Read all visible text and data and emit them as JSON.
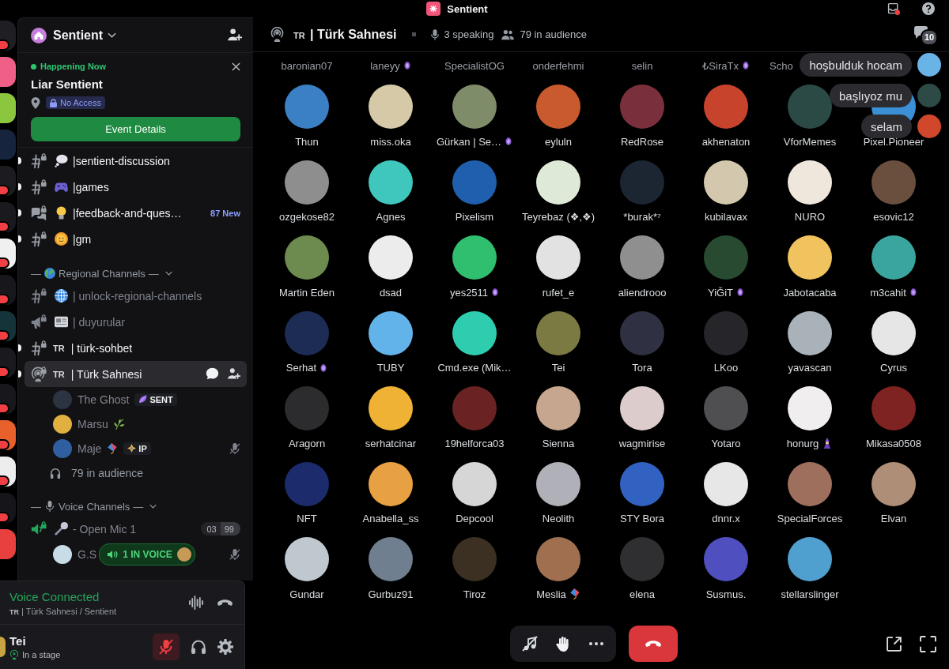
{
  "title_bar": {
    "title": "Sentient",
    "unread": true
  },
  "servers": [
    {
      "color": "#1f1f23",
      "badge": true
    },
    {
      "color": "#ef5f86",
      "badge": false
    },
    {
      "color": "#8cc63f",
      "badge": false
    },
    {
      "color": "#16243d",
      "badge": false
    },
    {
      "color": "#1c1c20",
      "badge": true
    },
    {
      "color": "#1a1a1e",
      "badge": true
    },
    {
      "color": "#f0f0f0",
      "badge": true
    },
    {
      "color": "#18181c",
      "badge": true
    },
    {
      "color": "#14343a",
      "badge": true
    },
    {
      "color": "#1a1a1e",
      "badge": true
    },
    {
      "color": "#18181c",
      "badge": true
    },
    {
      "color": "#e8602c",
      "badge": true
    },
    {
      "color": "#ededed",
      "badge": true
    },
    {
      "color": "#16161a",
      "badge": true
    },
    {
      "color": "#e8403f",
      "badge": false
    }
  ],
  "server": {
    "name": "Sentient"
  },
  "event": {
    "status": "Happening Now",
    "title": "Liar Sentient",
    "access": "No Access",
    "button": "Event Details"
  },
  "channels": [
    {
      "kind": "text",
      "emoji": {
        "kind": "thought"
      },
      "name": "|sentient-discussion",
      "unread": true,
      "selected": false,
      "active": false
    },
    {
      "kind": "text",
      "emoji": {
        "kind": "gamepad"
      },
      "name": "|games",
      "unread": true,
      "selected": false,
      "active": false
    },
    {
      "kind": "forum",
      "emoji": {
        "kind": "bulb"
      },
      "name": "|feedback-and-ques…",
      "badge": "87 New",
      "unread": true,
      "selected": false,
      "active": false
    },
    {
      "kind": "text",
      "emoji": {
        "kind": "sun"
      },
      "name": "|gm",
      "unread": true,
      "selected": false,
      "active": false
    }
  ],
  "categories": [
    {
      "dash_before": "—",
      "emoji": {
        "kind": "earth"
      },
      "name": "Regional Channels",
      "dash_after": "—",
      "expanded": true,
      "channels": [
        {
          "kind": "text",
          "emoji": {
            "kind": "globe"
          },
          "name": "| unlock-regional-channels",
          "unread": false,
          "selected": false,
          "active": false
        },
        {
          "kind": "announcement",
          "emoji": {
            "kind": "newspaper"
          },
          "name": "| duyurular",
          "unread": false,
          "selected": false,
          "active": false
        },
        {
          "kind": "text",
          "flag": "TR",
          "name": "| türk-sohbet",
          "unread": true,
          "selected": false,
          "active": false
        },
        {
          "kind": "stage",
          "flag": "TR",
          "name": "| Türk Sahnesi",
          "unread": true,
          "selected": true,
          "active": false,
          "members": [
            {
              "name": "The Ghost",
              "color": "#2b3441",
              "guild_tag": {
                "kind": "leaf",
                "label": "SENT"
              },
              "muted": false
            },
            {
              "name": "Marsu",
              "color": "#e0b040",
              "emoji": {
                "kind": "herb"
              },
              "muted": false
            },
            {
              "name": "Maje",
              "color": "#2f5fa0",
              "emoji": {
                "kind": "kite"
              },
              "guild_tag": {
                "kind": "diamond",
                "label": "IP"
              },
              "muted": true
            }
          ],
          "audience": "79 in audience"
        }
      ]
    },
    {
      "dash_before": "—",
      "emoji": {
        "kind": "studio_mic"
      },
      "name": "Voice Channels",
      "dash_after": "—",
      "expanded": true,
      "channels": [
        {
          "kind": "voice",
          "emoji": {
            "kind": "mic"
          },
          "name": "- Open Mic 1",
          "unread": false,
          "selected": false,
          "active": true,
          "user_count": "03",
          "user_limit": "99",
          "members": [
            {
              "name": "G.S",
              "color": "#c8dce8",
              "pill": {
                "label": "1 IN VOICE",
                "color": "#c79a58"
              },
              "muted": true
            }
          ]
        }
      ]
    }
  ],
  "voice_panel": {
    "status": "Voice Connected",
    "flag": "TR",
    "channel": "| Türk Sahnesi / Sentient"
  },
  "user": {
    "name": "Tei",
    "status": "In a stage",
    "color": "#c9a443",
    "mic_muted": true,
    "deafened": false
  },
  "stage": {
    "flag": "TR",
    "name": "| Türk Sahnesi",
    "speaking": "3 speaking",
    "audience": "79 in audience",
    "threads_count": "10"
  },
  "top_row": [
    {
      "name": "baronian07"
    },
    {
      "name": "laneyy",
      "tag": {
        "kind": "badge"
      }
    },
    {
      "name": "SpecialistOG"
    },
    {
      "name": "onderfehmi"
    },
    {
      "name": "selin"
    },
    {
      "name": "₺SiraTx",
      "tag": {
        "kind": "badge"
      }
    },
    {
      "name": "Scho"
    }
  ],
  "participants": [
    {
      "name": "Thun",
      "color": "#3b7fc4"
    },
    {
      "name": "miss.oka",
      "color": "#d6c9a8"
    },
    {
      "name": "Gürkan | Se…",
      "color": "#7f8c6a",
      "tag": {
        "kind": "badge"
      }
    },
    {
      "name": "eyluln",
      "color": "#c85a2e"
    },
    {
      "name": "RedRose",
      "color": "#7a2f3c"
    },
    {
      "name": "akhenaton",
      "color": "#c8432c"
    },
    {
      "name": "VforMemes",
      "color": "#2b4a45"
    },
    {
      "name": "Pixel.Pioneer",
      "color": "#3b8fd6"
    },
    {
      "name": "ozgekose82",
      "color": "#8e8e8e"
    },
    {
      "name": "Agnes",
      "color": "#3fc6bd"
    },
    {
      "name": "Pixelism",
      "color": "#1f5fae"
    },
    {
      "name": "Teyrebaz (❖,❖)",
      "color": "#dfe9d8"
    },
    {
      "name": "*burak*⁷",
      "color": "#1c2633"
    },
    {
      "name": "kubilavax",
      "color": "#d3c8ae"
    },
    {
      "name": "NURO",
      "color": "#efe6dc"
    },
    {
      "name": "esovic12",
      "color": "#6b4f3e"
    },
    {
      "name": "Martin Eden",
      "color": "#6d8a4f"
    },
    {
      "name": "dsad",
      "color": "#ececec"
    },
    {
      "name": "yes2511",
      "color": "#2fbf6e",
      "tag": {
        "kind": "badge"
      }
    },
    {
      "name": "rufet_e",
      "color": "#e2e2e2"
    },
    {
      "name": "aliendrooo",
      "color": "#8f8f8f"
    },
    {
      "name": "YiĞiT",
      "color": "#284a31",
      "tag": {
        "kind": "badge"
      }
    },
    {
      "name": "Jabotacaba",
      "color": "#f1c35e"
    },
    {
      "name": "m3cahit",
      "color": "#3aa59e",
      "tag": {
        "kind": "badge"
      }
    },
    {
      "name": "Serhat",
      "color": "#1c2c55",
      "tag": {
        "kind": "badge"
      }
    },
    {
      "name": "TUBY",
      "color": "#62b3ea"
    },
    {
      "name": "Cmd.exe (Mik…",
      "color": "#2fcdb0"
    },
    {
      "name": "Tei",
      "color": "#7b7a42"
    },
    {
      "name": "Tora",
      "color": "#2f3042"
    },
    {
      "name": "LKoo",
      "color": "#26262a"
    },
    {
      "name": "yavascan",
      "color": "#a9b1b9"
    },
    {
      "name": "Cyrus",
      "color": "#e6e6e6"
    },
    {
      "name": "Aragorn",
      "color": "#2c2c2e"
    },
    {
      "name": "serhatcinar",
      "color": "#efb234"
    },
    {
      "name": "19helforca03",
      "color": "#6b2222"
    },
    {
      "name": "Sienna",
      "color": "#c6a68e"
    },
    {
      "name": "wagmirise",
      "color": "#dccccc"
    },
    {
      "name": "Yotaro",
      "color": "#4f4f52"
    },
    {
      "name": "honurg",
      "color": "#f0eeee",
      "tag": {
        "kind": "wizard"
      }
    },
    {
      "name": "Mikasa0508",
      "color": "#7e2222"
    },
    {
      "name": "NFT",
      "color": "#1b2b6b"
    },
    {
      "name": "Anabella_ss",
      "color": "#e7a142"
    },
    {
      "name": "Depcool",
      "color": "#d6d6d6"
    },
    {
      "name": "Neolith",
      "color": "#afb0b8"
    },
    {
      "name": "STY Bora",
      "color": "#3162c2"
    },
    {
      "name": "dnnr.x",
      "color": "#e7e7e7"
    },
    {
      "name": "SpecialForces",
      "color": "#9f6f5e"
    },
    {
      "name": "Elvan",
      "color": "#ae8e76"
    },
    {
      "name": "Gundar",
      "color": "#bfc7cf"
    },
    {
      "name": "Gurbuz91",
      "color": "#6f7f8f"
    },
    {
      "name": "Tiroz",
      "color": "#3b3021"
    },
    {
      "name": "Meslia",
      "color": "#9f6f4f",
      "tag": {
        "kind": "kite"
      }
    },
    {
      "name": "elena",
      "color": "#2f2f31"
    },
    {
      "name": "Susmus.",
      "color": "#4f4fbf"
    },
    {
      "name": "stellarslinger",
      "color": "#4fa0cf"
    }
  ],
  "chat": [
    {
      "text": "hoşbulduk hocam",
      "color": "#69b3e6"
    },
    {
      "text": "başlıyoz mu",
      "color": "#2d4a46"
    },
    {
      "text": "selam",
      "color": "#d0472b"
    }
  ]
}
